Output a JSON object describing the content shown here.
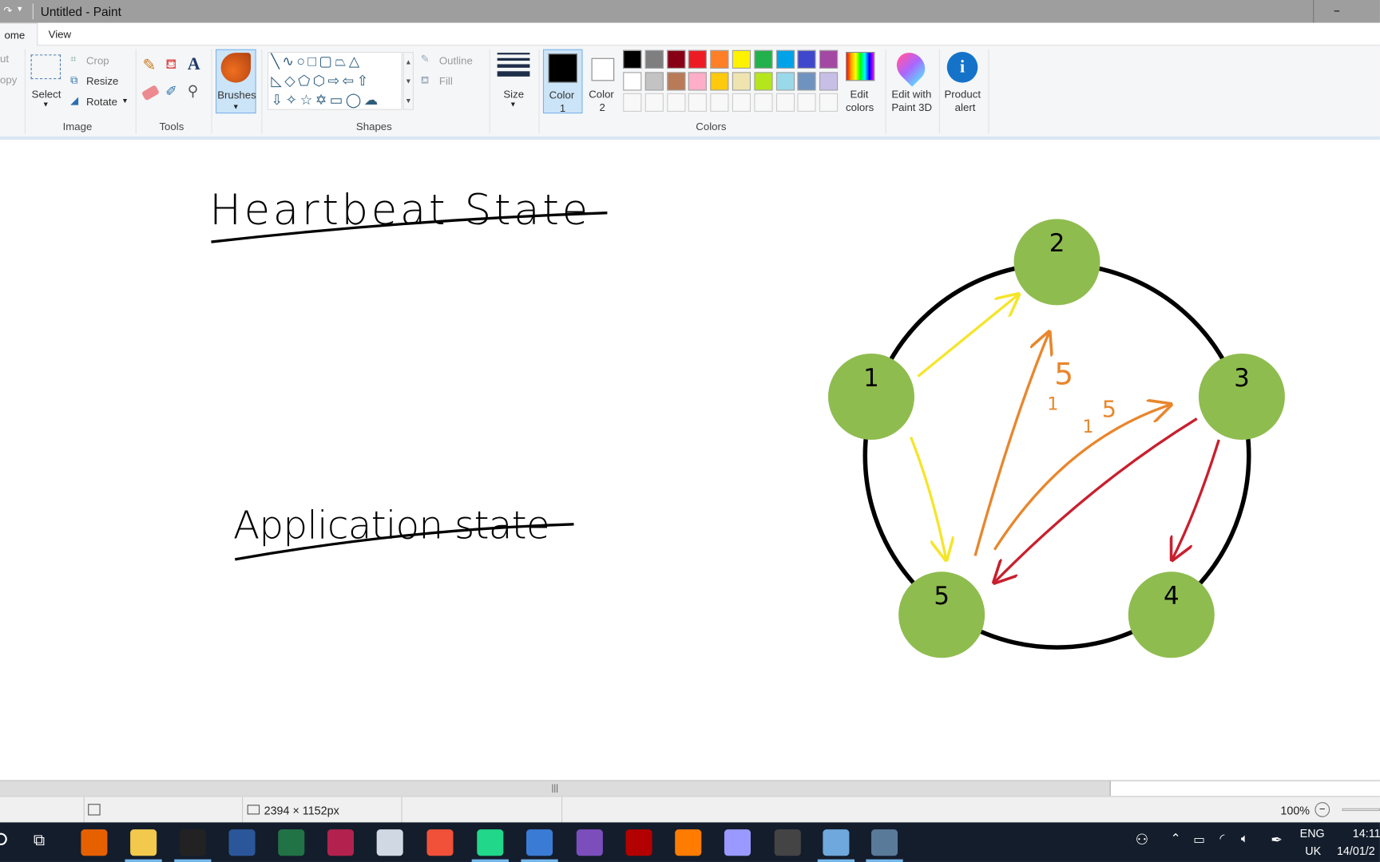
{
  "window": {
    "title": "Untitled - Paint",
    "minimize": "–"
  },
  "tabs": [
    {
      "label": "ome",
      "active": true
    },
    {
      "label": "View",
      "active": false
    }
  ],
  "ribbon": {
    "clipboard": {
      "cut": "ut",
      "copy": "opy"
    },
    "image": {
      "select": "Select",
      "crop": "Crop",
      "resize": "Resize",
      "rotate": "Rotate",
      "label": "Image"
    },
    "tools": {
      "label": "Tools"
    },
    "brushes": {
      "label": "Brushes"
    },
    "shapes": {
      "outline": "Outline",
      "fill": "Fill",
      "label": "Shapes"
    },
    "size": {
      "label": "Size"
    },
    "colors": {
      "color1": "Color",
      "color1_n": "1",
      "color2": "Color",
      "color2_n": "2",
      "edit": "Edit",
      "edit2": "colors",
      "label": "Colors",
      "row1": [
        "#000000",
        "#7f7f7f",
        "#880015",
        "#ed1c24",
        "#ff7f27",
        "#fff200",
        "#22b14c",
        "#00a2e8",
        "#3f48cc",
        "#a349a4"
      ],
      "row2": [
        "#ffffff",
        "#c3c3c3",
        "#b97a57",
        "#ffaec9",
        "#ffc90e",
        "#efe4b0",
        "#b5e61d",
        "#99d9ea",
        "#7092be",
        "#c8bfe7"
      ]
    },
    "paint3d": {
      "l1": "Edit with",
      "l2": "Paint 3D"
    },
    "alert": {
      "l1": "Product",
      "l2": "alert"
    }
  },
  "canvas": {
    "heading1": "Heartbeat State",
    "heading2": "Application state",
    "nodes": [
      "1",
      "2",
      "3",
      "4",
      "5"
    ],
    "labels": [
      "5",
      "5",
      "1",
      "1"
    ],
    "node_color": "#8fbc4f"
  },
  "status": {
    "dimensions": "2394 × 1152px",
    "zoom": "100%"
  },
  "taskbar": {
    "apps": [
      "Firefox",
      "File Explorer",
      "Terminal",
      "W",
      "X",
      "RM",
      "Paint brush",
      "Swift",
      "PC",
      "Network",
      "Visual Studio",
      "Fz",
      "Ai",
      "Pr",
      "OBS",
      "VirtualBox",
      "Paint"
    ],
    "lang1": "ENG",
    "lang2": "UK",
    "time": "14:11",
    "date": "14/01/2"
  }
}
